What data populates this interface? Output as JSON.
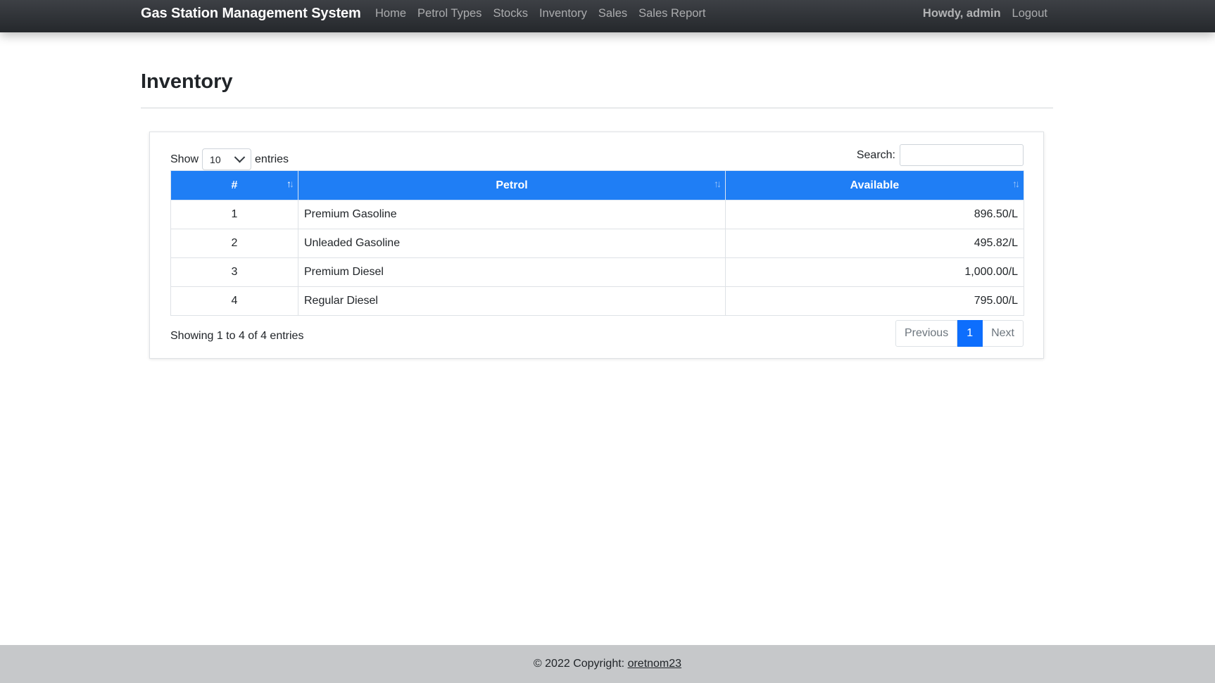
{
  "navbar": {
    "brand": "Gas Station Management System",
    "links": [
      "Home",
      "Petrol Types",
      "Stocks",
      "Inventory",
      "Sales",
      "Sales Report"
    ],
    "howdy": "Howdy, admin",
    "logout": "Logout"
  },
  "page": {
    "title": "Inventory"
  },
  "table_controls": {
    "show_label": "Show",
    "entries_label": "entries",
    "page_length": "10",
    "search_label": "Search:",
    "search_value": ""
  },
  "table": {
    "headers": [
      "#",
      "Petrol",
      "Available"
    ],
    "rows": [
      {
        "num": "1",
        "petrol": "Premium Gasoline",
        "available": "896.50/L"
      },
      {
        "num": "2",
        "petrol": "Unleaded Gasoline",
        "available": "495.82/L"
      },
      {
        "num": "3",
        "petrol": "Premium Diesel",
        "available": "1,000.00/L"
      },
      {
        "num": "4",
        "petrol": "Regular Diesel",
        "available": "795.00/L"
      }
    ]
  },
  "pagination": {
    "info": "Showing 1 to 4 of 4 entries",
    "previous": "Previous",
    "current": "1",
    "next": "Next"
  },
  "footer": {
    "text": "© 2022 Copyright: ",
    "link": "oretnom23"
  },
  "colors": {
    "navbar": "#2b2e33",
    "table_header": "#1f7ef5",
    "page_active": "#0d6efd",
    "footer": "#c6c8ca"
  },
  "icons": [
    "sort-icon",
    "chevron-down-icon"
  ]
}
